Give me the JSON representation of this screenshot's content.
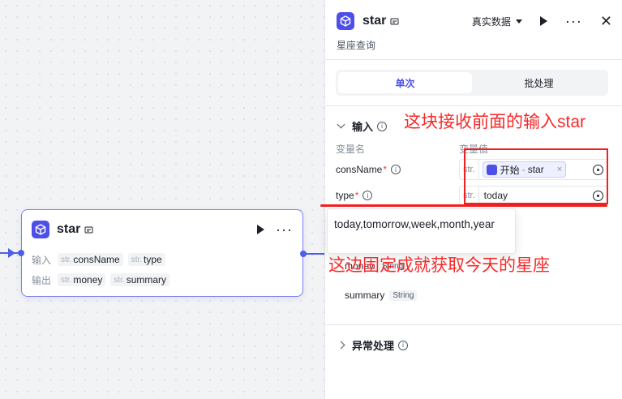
{
  "node": {
    "title": "star",
    "input_label": "输入",
    "output_label": "输出",
    "inputs": [
      {
        "type": "str.",
        "name": "consName"
      },
      {
        "type": "str.",
        "name": "type"
      }
    ],
    "outputs": [
      {
        "type": "str.",
        "name": "money"
      },
      {
        "type": "str.",
        "name": "summary"
      }
    ]
  },
  "panel": {
    "title": "star",
    "subtitle": "星座查询",
    "dataset_label": "真实数据",
    "tabs": [
      "单次",
      "批处理"
    ],
    "input_section": "输入",
    "col_name": "变量名",
    "col_value": "变量值",
    "fields": [
      {
        "label": "consName",
        "type": "str.",
        "ref_source": "开始",
        "ref_sep": "-",
        "ref_var": "star"
      },
      {
        "label": "type",
        "type": "str.",
        "value": "today"
      }
    ],
    "outputs": [
      {
        "name": "money",
        "type": "String"
      },
      {
        "name": "summary",
        "type": "String"
      }
    ],
    "error_section": "异常处理"
  },
  "dropdown_text": "today,tomorrow,week,month,year",
  "annotations": {
    "top": "这块接收前面的输入star",
    "bottom": "这边固定成就获取今天的星座"
  },
  "colors": {
    "accent": "#4e4fe8",
    "annotation": "#f52a2a"
  }
}
